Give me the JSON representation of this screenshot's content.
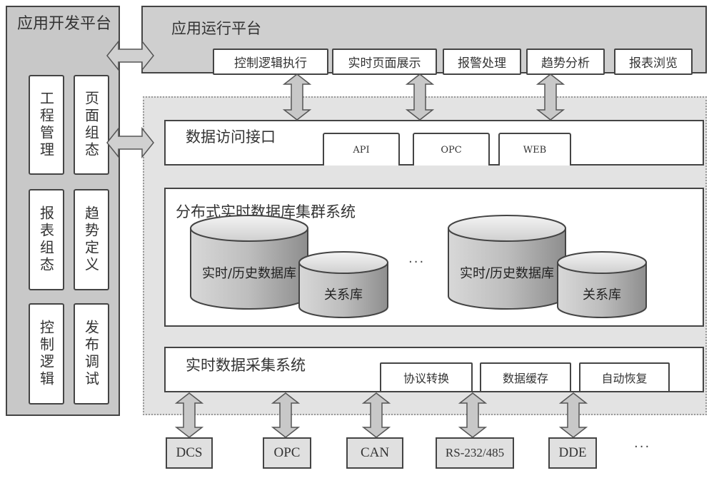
{
  "dev_platform": {
    "title": "应用开发平台",
    "modules": [
      {
        "label": "工程管理"
      },
      {
        "label": "页面组态"
      },
      {
        "label": "报表组态"
      },
      {
        "label": "趋势定义"
      },
      {
        "label": "控制逻辑"
      },
      {
        "label": "发布调试"
      }
    ]
  },
  "run_platform": {
    "title": "应用运行平台",
    "modules": [
      {
        "label": "控制逻辑执行"
      },
      {
        "label": "实时页面展示"
      },
      {
        "label": "报警处理"
      },
      {
        "label": "趋势分析"
      },
      {
        "label": "报表浏览"
      }
    ]
  },
  "data_access": {
    "title": "数据访问接口",
    "interfaces": [
      {
        "label": "API"
      },
      {
        "label": "OPC"
      },
      {
        "label": "WEB"
      }
    ]
  },
  "db_cluster": {
    "title": "分布式实时数据库集群系统",
    "nodes": [
      {
        "rt_db": "实时/历史数据库",
        "rel_db": "关系库"
      },
      {
        "rt_db": "实时/历史数据库",
        "rel_db": "关系库"
      }
    ],
    "ellipsis": "···"
  },
  "acquisition": {
    "title": "实时数据采集系统",
    "features": [
      {
        "label": "协议转换"
      },
      {
        "label": "数据缓存"
      },
      {
        "label": "自动恢复"
      }
    ]
  },
  "sources": {
    "items": [
      {
        "label": "DCS"
      },
      {
        "label": "OPC"
      },
      {
        "label": "CAN"
      },
      {
        "label": "RS-232/485"
      },
      {
        "label": "DDE"
      }
    ],
    "ellipsis": "···"
  }
}
